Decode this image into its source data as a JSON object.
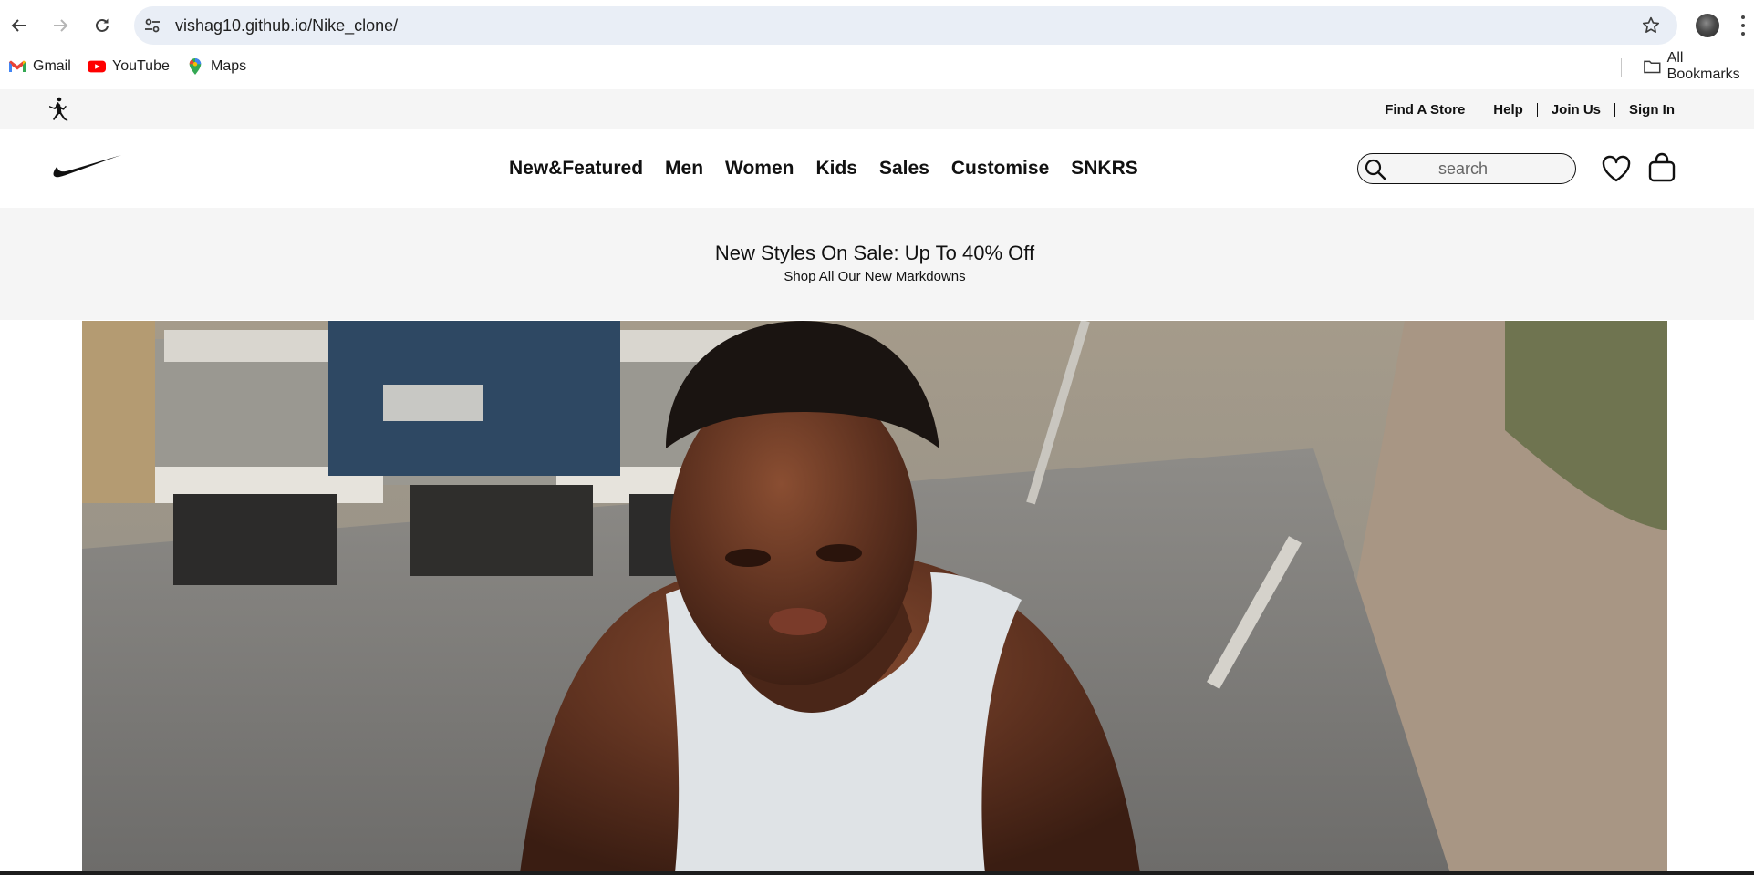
{
  "browser": {
    "url": "vishag10.github.io/Nike_clone/",
    "bookmarks": [
      {
        "label": "Gmail",
        "icon": "gmail-icon"
      },
      {
        "label": "YouTube",
        "icon": "youtube-icon"
      },
      {
        "label": "Maps",
        "icon": "maps-icon"
      }
    ],
    "all_bookmarks_label": "All Bookmarks"
  },
  "utility_bar": {
    "links": [
      "Find A Store",
      "Help",
      "Join Us",
      "Sign In"
    ]
  },
  "header": {
    "nav": [
      "New&Featured",
      "Men",
      "Women",
      "Kids",
      "Sales",
      "Customise",
      "SNKRS"
    ],
    "search_placeholder": "search"
  },
  "promo": {
    "title": "New Styles On Sale: Up To 40% Off",
    "subtitle": "Shop All Our New Markdowns"
  },
  "colors": {
    "text": "#111111",
    "util_bg": "#f5f5f5",
    "omnibox_bg": "#e9eef6"
  }
}
